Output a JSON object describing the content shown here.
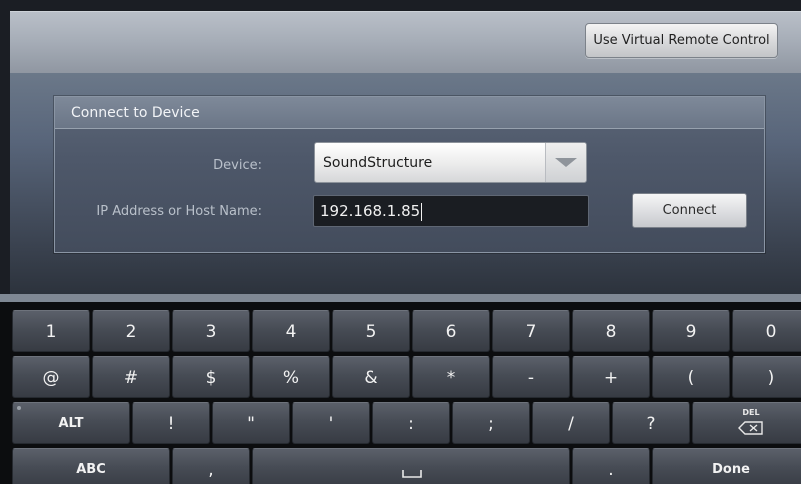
{
  "header": {
    "virtual_remote_label": "Use Virtual Remote Control"
  },
  "panel": {
    "title": "Connect to Device",
    "device_label": "Device:",
    "device_value": "SoundStructure",
    "ip_label": "IP Address or Host Name:",
    "ip_value": "192.168.1.85",
    "connect_label": "Connect"
  },
  "keyboard": {
    "row1": [
      "1",
      "2",
      "3",
      "4",
      "5",
      "6",
      "7",
      "8",
      "9",
      "0"
    ],
    "row2": [
      "@",
      "#",
      "$",
      "%",
      "&",
      "*",
      "-",
      "+",
      "(",
      ")"
    ],
    "row3": {
      "alt": "ALT",
      "keys": [
        "!",
        "\"",
        "'",
        ":",
        ";",
        "/",
        "?"
      ],
      "del": "DEL"
    },
    "row4": {
      "abc": "ABC",
      "comma": ",",
      "space": "␣",
      "period": ".",
      "done": "Done"
    }
  },
  "icons": {
    "device_dropdown": "chevron-down-icon",
    "delete": "backspace-icon",
    "space": "space-bar-icon"
  },
  "colors": {
    "keyboard_bg": "#0c0d0f",
    "key_face": "#474c55",
    "panel_bg": "#4e586a"
  }
}
